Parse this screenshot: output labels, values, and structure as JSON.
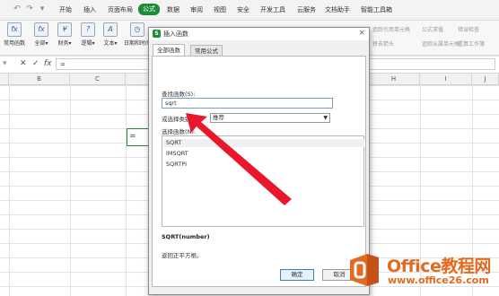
{
  "quick_access": [
    "undo-icon",
    "redo-icon",
    "dropdown-icon"
  ],
  "menu_tabs": [
    "开始",
    "插入",
    "页面布局",
    "公式",
    "数据",
    "审阅",
    "视图",
    "安全",
    "开发工具",
    "云服务",
    "文档助手",
    "智能工具箱"
  ],
  "active_tab": "公式",
  "ribbon": {
    "buttons": [
      "常用函数",
      "全部",
      "财务",
      "逻辑",
      "文本",
      "日期和时间"
    ],
    "right_faint": [
      "追踪引用单元格",
      "移去箭头",
      "公式求值",
      "追踪从属单元格",
      "错误检查",
      "重算工作簿"
    ]
  },
  "formula_bar": {
    "cancel_symbol": "✕",
    "confirm_symbol": "✓",
    "fx_label": "fx",
    "value": "="
  },
  "columns": [
    "B",
    "C",
    "H",
    "I",
    "J"
  ],
  "active_cell_value": "=",
  "dialog": {
    "title": "插入函数",
    "logo_letter": "S",
    "close_symbol": "×",
    "tabs": [
      "全部函数",
      "常用公式"
    ],
    "search_label": "查找函数(S):",
    "search_value": "sqrt",
    "category_label": "或选择类别(C):",
    "category_value": "推荐",
    "list_label": "选择函数(N):",
    "functions": [
      "SQRT",
      "IMSQRT",
      "SQRTPI"
    ],
    "selected_function": "SQRT",
    "signature": "SQRT(number)",
    "description": "返回正平方根。",
    "ok_label": "确定",
    "cancel_label": "取消"
  },
  "watermark": {
    "title": "Office教程网",
    "url": "www.office26.com"
  },
  "colors": {
    "accent_green": "#1e8b3a",
    "arrow_red": "#e8182a",
    "watermark_orange": "#e36a1e"
  }
}
